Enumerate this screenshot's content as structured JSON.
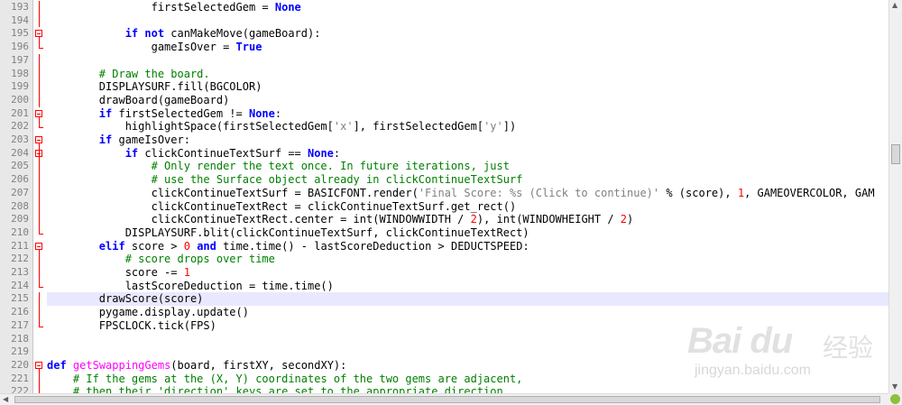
{
  "editor": {
    "language": "python",
    "current_line": 215,
    "lines": [
      {
        "n": "193",
        "html": "                firstSelectedGem = <span class='kw'>None</span>"
      },
      {
        "n": "194",
        "html": ""
      },
      {
        "n": "195",
        "html": "            <span class='kw'>if not</span> canMakeMove(gameBoard):"
      },
      {
        "n": "196",
        "html": "                gameIsOver = <span class='kw'>True</span>"
      },
      {
        "n": "197",
        "html": ""
      },
      {
        "n": "198",
        "html": "        <span class='cm'># Draw the board.</span>"
      },
      {
        "n": "199",
        "html": "        DISPLAYSURF.fill(BGCOLOR)"
      },
      {
        "n": "200",
        "html": "        drawBoard(gameBoard)"
      },
      {
        "n": "201",
        "html": "        <span class='kw'>if</span> firstSelectedGem != <span class='kw'>None</span>:"
      },
      {
        "n": "202",
        "html": "            highlightSpace(firstSelectedGem[<span class='str'>'x'</span>], firstSelectedGem[<span class='str'>'y'</span>])"
      },
      {
        "n": "203",
        "html": "        <span class='kw'>if</span> gameIsOver:"
      },
      {
        "n": "204",
        "html": "            <span class='kw'>if</span> clickContinueTextSurf == <span class='kw'>None</span>:"
      },
      {
        "n": "205",
        "html": "                <span class='cm'># Only render the text once. In future iterations, just</span>"
      },
      {
        "n": "206",
        "html": "                <span class='cm'># use the Surface object already in clickContinueTextSurf</span>"
      },
      {
        "n": "207",
        "html": "                clickContinueTextSurf = BASICFONT.render(<span class='str'>'Final Score: %s (Click to continue)'</span> % (score), <span class='num'>1</span>, GAMEOVERCOLOR, GAM"
      },
      {
        "n": "208",
        "html": "                clickContinueTextRect = clickContinueTextSurf.get_rect()"
      },
      {
        "n": "209",
        "html": "                clickContinueTextRect.center = int(WINDOWWIDTH / <span class='num'>2</span>), int(WINDOWHEIGHT / <span class='num'>2</span>)"
      },
      {
        "n": "210",
        "html": "            DISPLAYSURF.blit(clickContinueTextSurf, clickContinueTextRect)"
      },
      {
        "n": "211",
        "html": "        <span class='kw'>elif</span> score &gt; <span class='num'>0</span> <span class='kw'>and</span> time.time() - lastScoreDeduction &gt; DEDUCTSPEED:"
      },
      {
        "n": "212",
        "html": "            <span class='cm'># score drops over time</span>"
      },
      {
        "n": "213",
        "html": "            score -= <span class='num'>1</span>"
      },
      {
        "n": "214",
        "html": "            lastScoreDeduction = time.time()"
      },
      {
        "n": "215",
        "html": "        drawScore(score)"
      },
      {
        "n": "216",
        "html": "        pygame.display.update()"
      },
      {
        "n": "217",
        "html": "        FPSCLOCK.tick(FPS)"
      },
      {
        "n": "218",
        "html": ""
      },
      {
        "n": "219",
        "html": ""
      },
      {
        "n": "220",
        "html": "<span class='kw'>def</span> <span class='def'>getSwappingGems</span>(board, firstXY, secondXY):"
      },
      {
        "n": "221",
        "html": "    <span class='cm'># If the gems at the (X, Y) coordinates of the two gems are adjacent,</span>"
      },
      {
        "n": "222",
        "html": "    <span class='cm'># then their 'direction' keys are set to the appropriate direction</span>"
      }
    ],
    "fold_markers": [
      195,
      201,
      203,
      204,
      211,
      220
    ],
    "colors": {
      "keyword": "#0000ff",
      "comment": "#008000",
      "number": "#ff0000",
      "string": "#808080",
      "function": "#ff00ff",
      "fold": "#ff0000"
    }
  },
  "watermark": {
    "logo": "Bai du",
    "cn": "经验",
    "url": "jingyan.baidu.com"
  }
}
